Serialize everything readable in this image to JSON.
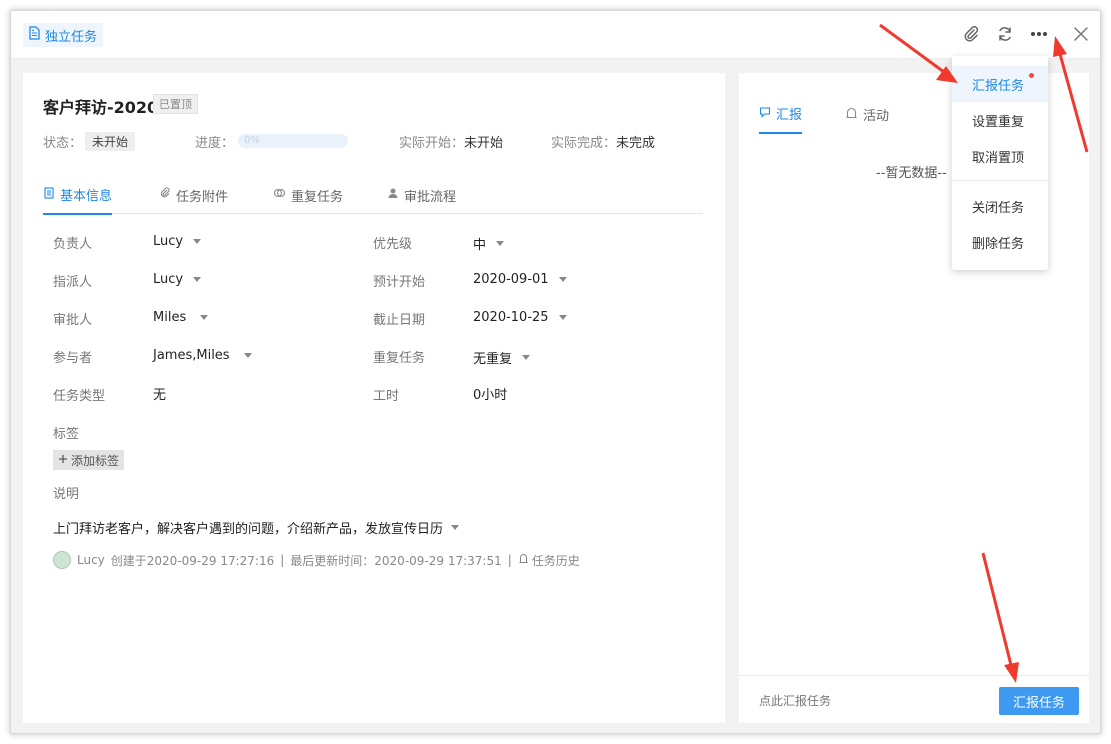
{
  "header": {
    "type_tag": "独立任务"
  },
  "task": {
    "title": "客户拜访-2020",
    "pinned_badge": "已置顶",
    "status_label": "状态：",
    "status_value": "未开始",
    "progress_label": "进度：",
    "progress_value": "0%",
    "progress_fraction": 0,
    "actual_start_label": "实际开始：",
    "actual_start_value": "未开始",
    "actual_finish_label": "实际完成：",
    "actual_finish_value": "未完成"
  },
  "tabs": [
    {
      "label": "基本信息",
      "icon": "document-icon",
      "active": true
    },
    {
      "label": "任务附件",
      "icon": "paperclip-icon",
      "active": false
    },
    {
      "label": "重复任务",
      "icon": "repeat-icon",
      "active": false
    },
    {
      "label": "审批流程",
      "icon": "user-icon",
      "active": false
    }
  ],
  "fields": {
    "owner": {
      "label": "负责人",
      "value": "Lucy"
    },
    "assigner": {
      "label": "指派人",
      "value": "Lucy"
    },
    "approver": {
      "label": "审批人",
      "value": "Miles"
    },
    "participants": {
      "label": "参与者",
      "value": "James,Miles"
    },
    "task_type": {
      "label": "任务类型",
      "value": "无"
    },
    "priority": {
      "label": "优先级",
      "value": "中"
    },
    "planned_start": {
      "label": "预计开始",
      "value": "2020-09-01"
    },
    "deadline": {
      "label": "截止日期",
      "value": "2020-10-25"
    },
    "repeat": {
      "label": "重复任务",
      "value": "无重复"
    },
    "work_hours": {
      "label": "工时",
      "value": "0小时"
    }
  },
  "tags": {
    "label": "标签",
    "add_button": "添加标签"
  },
  "description": {
    "label": "说明",
    "text": "上门拜访老客户，解决客户遇到的问题，介绍新产品，发放宣传日历"
  },
  "history": {
    "user": "Lucy",
    "created": "创建于2020-09-29 17:27:16",
    "sep1": "|",
    "updated": "最后更新时间：2020-09-29 17:37:51",
    "sep2": "|",
    "history_link": "任务历史"
  },
  "right_panel": {
    "tabs": [
      {
        "label": "汇报",
        "icon": "report-icon",
        "active": true
      },
      {
        "label": "活动",
        "icon": "activity-icon",
        "active": false
      }
    ],
    "empty_text": "--暂无数据--",
    "footer_hint": "点此汇报任务",
    "report_button": "汇报任务"
  },
  "more_menu": {
    "items": [
      "汇报任务",
      "设置重复",
      "取消置顶"
    ],
    "items_after_divider": [
      "关闭任务",
      "删除任务"
    ]
  },
  "colors": {
    "accent": "#1e88e5",
    "button": "#3d9af0",
    "arrow": "#f03a2e"
  }
}
